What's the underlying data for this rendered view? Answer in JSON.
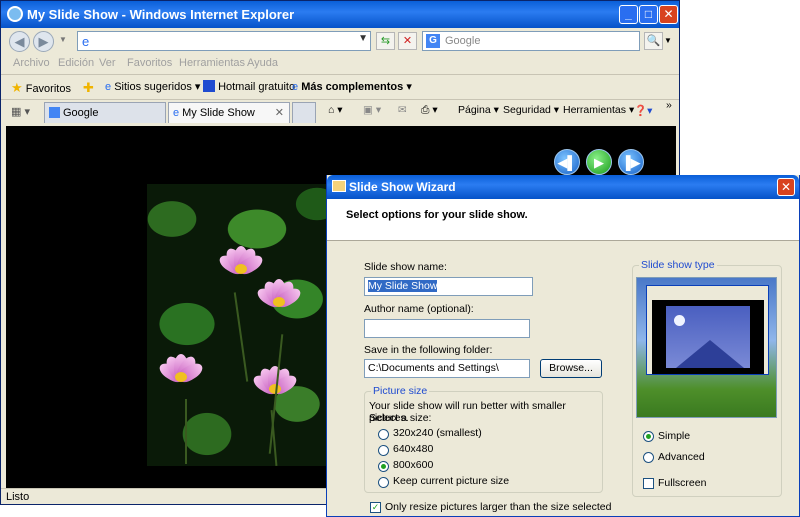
{
  "browser": {
    "title": "My Slide Show - Windows Internet Explorer",
    "search_placeholder": "Google",
    "menu": [
      "Archivo",
      "Edición",
      "Ver",
      "Favoritos",
      "Herramientas",
      "Ayuda"
    ],
    "favorites": {
      "favoritos": "Favoritos",
      "suggested": "Sitios sugeridos",
      "hotmail": "Hotmail gratuito",
      "addons": "Más complementos"
    },
    "tabs": [
      "Google",
      "My Slide Show"
    ],
    "commands": [
      "Página",
      "Seguridad",
      "Herramientas"
    ],
    "status": "Listo"
  },
  "wizard": {
    "title": "Slide Show Wizard",
    "header": "Select options for your slide show.",
    "name_label": "Slide show name:",
    "name_value": "My Slide Show",
    "author_label": "Author name (optional):",
    "author_value": "",
    "folder_label": "Save in the following folder:",
    "folder_value": "C:\\Documents and Settings\\",
    "browse_label": "Browse...",
    "picture_size": {
      "legend": "Picture size",
      "hint": "Your slide show will run better with smaller pictures.",
      "select_label": "Select a size:",
      "options": [
        "320x240 (smallest)",
        "640x480",
        "800x600",
        "Keep current picture size"
      ],
      "selected": "800x600"
    },
    "resize_checkbox": "Only resize pictures larger than the size selected",
    "resize_checked": true,
    "type_group": {
      "legend": "Slide show type",
      "options": [
        "Simple",
        "Advanced"
      ],
      "selected": "Simple",
      "fullscreen_label": "Fullscreen",
      "fullscreen_checked": false
    }
  }
}
